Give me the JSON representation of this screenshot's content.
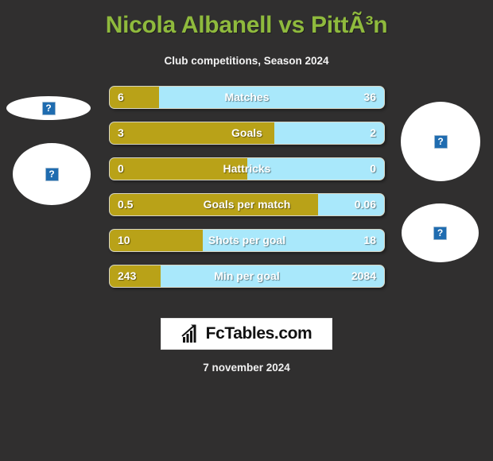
{
  "header": {
    "title": "Nicola Albanell vs PittÃ³n",
    "subtitle": "Club competitions, Season 2024"
  },
  "colors": {
    "background": "#302f2f",
    "title": "#8fba3d",
    "bar_left_fill": "#b9a218",
    "bar_right_fill": "#a9e8fb",
    "bar_border": "#d7d5c4",
    "text": "#ffffff"
  },
  "placeholders": [
    {
      "name": "player-left-photo-top",
      "alt": "?"
    },
    {
      "name": "player-left-photo-bottom",
      "alt": "?"
    },
    {
      "name": "player-right-photo-top",
      "alt": "?"
    },
    {
      "name": "player-right-photo-bottom",
      "alt": "?"
    }
  ],
  "chart_data": {
    "type": "bar",
    "title": "Nicola Albanell vs PittÃ³n",
    "subtitle": "Club competitions, Season 2024",
    "orientation": "horizontal-diverging",
    "series": [
      {
        "name": "Nicola Albanell",
        "color": "#b9a218"
      },
      {
        "name": "PittÃ³n",
        "color": "#a9e8fb"
      }
    ],
    "categories": [
      "Matches",
      "Goals",
      "Hattricks",
      "Goals per match",
      "Shots per goal",
      "Min per goal"
    ],
    "rows": [
      {
        "label": "Matches",
        "left_value": "6",
        "right_value": "36",
        "left_pct": 18
      },
      {
        "label": "Goals",
        "left_value": "3",
        "right_value": "2",
        "left_pct": 60
      },
      {
        "label": "Hattricks",
        "left_value": "0",
        "right_value": "0",
        "left_pct": 50
      },
      {
        "label": "Goals per match",
        "left_value": "0.5",
        "right_value": "0.06",
        "left_pct": 76
      },
      {
        "label": "Shots per goal",
        "left_value": "10",
        "right_value": "18",
        "left_pct": 34
      },
      {
        "label": "Min per goal",
        "left_value": "243",
        "right_value": "2084",
        "left_pct": 18.5
      }
    ]
  },
  "footer": {
    "logo_text": "FcTables.com",
    "logo_icon": "bar-chart-growth-icon",
    "date": "7 november 2024"
  }
}
